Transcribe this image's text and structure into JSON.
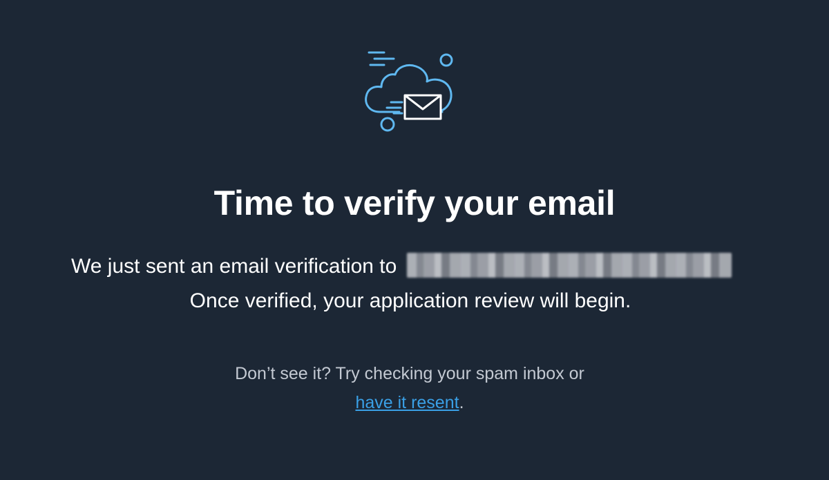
{
  "page": {
    "icon": "cloud-envelope-icon",
    "title": "Time to verify your email",
    "message_line1": "We just sent an email verification to",
    "message_line2": "Once verified, your application review will begin.",
    "hint_text": "Don’t see it? Try checking your spam inbox or",
    "resend_link": "have it resent",
    "resend_suffix": "."
  },
  "colors": {
    "background": "#1c2735",
    "icon_stroke": "#5fb8f0",
    "link": "#3aa0e6",
    "heading": "#ffffff",
    "muted_text": "#c3c9d2"
  }
}
